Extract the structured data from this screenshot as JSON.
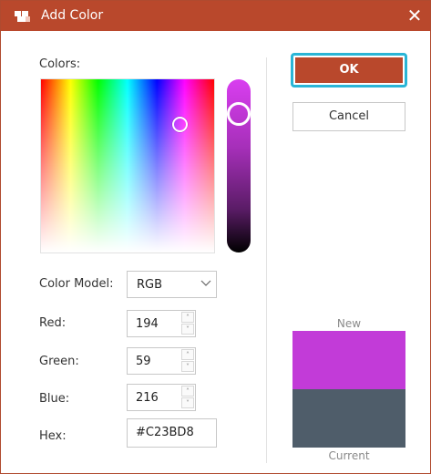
{
  "window": {
    "title": "Add Color",
    "close_glyph": "✕",
    "accent_color": "#b9482c",
    "focus_color": "#2ab5d6"
  },
  "picker": {
    "colors_label": "Colors:",
    "selected_hue_color": "#c23bd8"
  },
  "fields": {
    "color_model_label": "Color Model:",
    "color_model_value": "RGB",
    "color_model_options": [
      "RGB"
    ],
    "red_label": "Red:",
    "red_value": "194",
    "green_label": "Green:",
    "green_value": "59",
    "blue_label": "Blue:",
    "blue_value": "216",
    "hex_label": "Hex:",
    "hex_value": "#C23BD8"
  },
  "buttons": {
    "ok_label": "OK",
    "cancel_label": "Cancel"
  },
  "preview": {
    "new_label": "New",
    "new_color": "#c23bd8",
    "current_label": "Current",
    "current_color": "#4f5d6a"
  },
  "icons": {
    "app": "paint-bucket-icon",
    "close": "close-icon",
    "dropdown": "chevron-down-icon",
    "stepper_up": "chevron-up-icon",
    "stepper_down": "chevron-down-icon"
  }
}
